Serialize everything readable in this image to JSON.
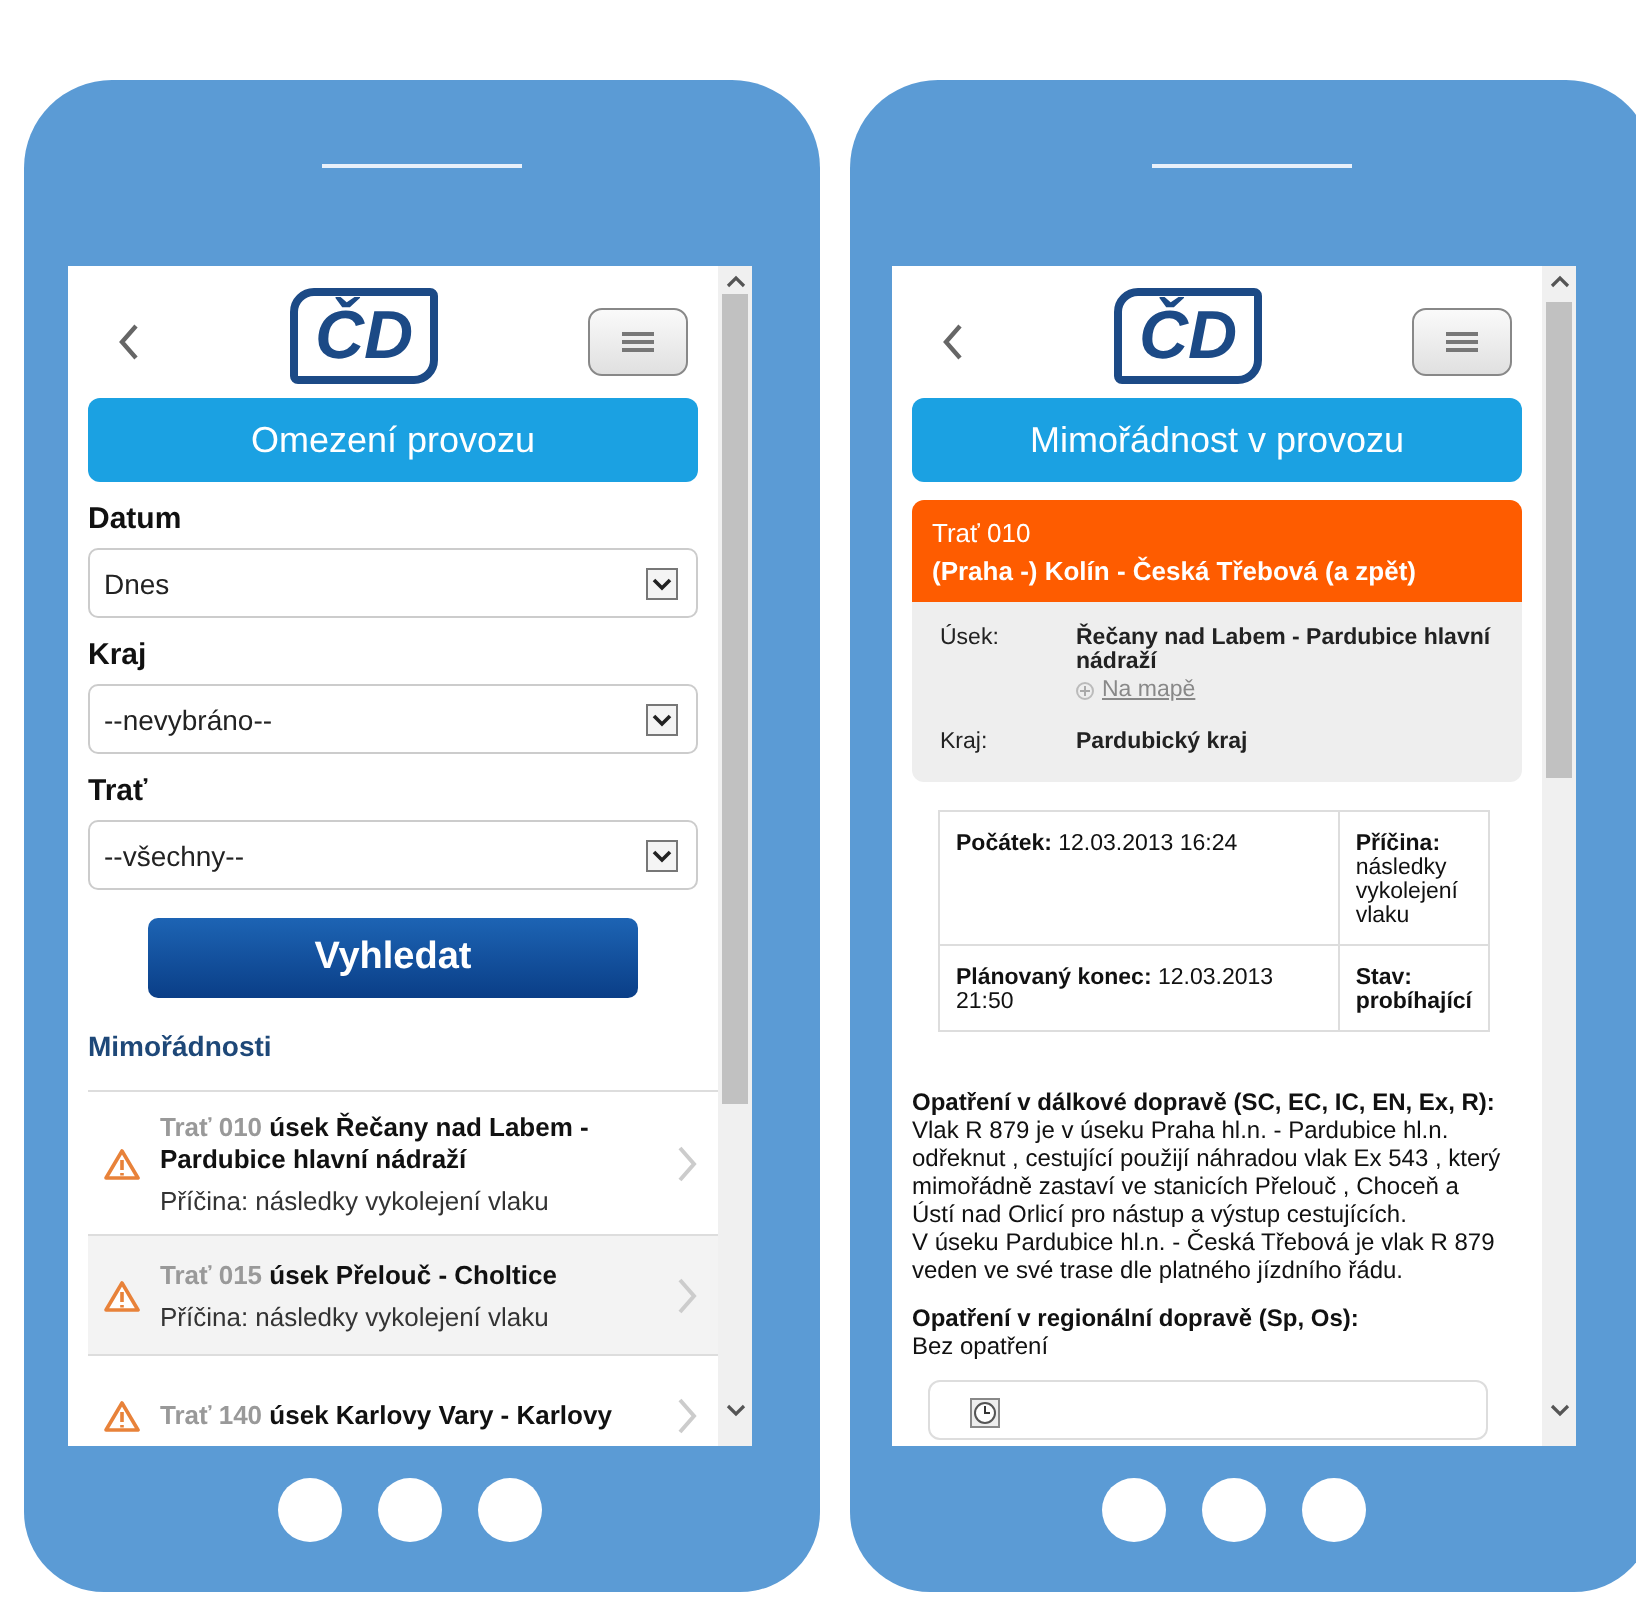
{
  "left_screen": {
    "logo": "ČD",
    "title": "Omezení provozu",
    "fields": [
      {
        "label": "Datum",
        "value": "Dnes"
      },
      {
        "label": "Kraj",
        "value": "--nevybráno--"
      },
      {
        "label": "Trať",
        "value": "--všechny--"
      }
    ],
    "search_button": "Vyhledat",
    "section_title": "Mimořádnosti",
    "incidents": [
      {
        "route": "Trať 010",
        "section": "úsek Řečany nad Labem - Pardubice hlavní nádraží",
        "cause": "Příčina: následky vykolejení vlaku"
      },
      {
        "route": "Trať 015",
        "section": "úsek Přelouč - Choltice",
        "cause": "Příčina: následky vykolejení vlaku"
      },
      {
        "route": "Trať 140",
        "section": "úsek Karlovy Vary - Karlovy"
      }
    ]
  },
  "right_screen": {
    "logo": "ČD",
    "title": "Mimořádnost v provozu",
    "line": {
      "number": "Trať 010",
      "name": "(Praha -) Kolín - Česká Třebová (a zpět)"
    },
    "details": [
      {
        "label": "Úsek:",
        "value": "Řečany nad Labem - Pardubice hlavní nádraží",
        "link": "Na mapě"
      },
      {
        "label": "Kraj:",
        "value": "Pardubický kraj"
      }
    ],
    "table": [
      [
        {
          "label": "Počátek:",
          "value": "12.03.2013 16:24",
          "value_bold": false
        },
        {
          "label": "Příčina:",
          "value": "následky vykolejení vlaku",
          "value_bold": false
        }
      ],
      [
        {
          "label": "Plánovaný konec:",
          "value": "12.03.2013 21:50",
          "value_bold": false
        },
        {
          "label": "Stav:",
          "value": "probíhající",
          "value_bold": true
        }
      ]
    ],
    "measures": [
      {
        "heading": "Opatření v dálkové dopravě (SC, EC, IC, EN, Ex, R):",
        "paragraphs": [
          "Vlak R 879 je v úseku Praha hl.n. - Pardubice hl.n. odřeknut , cestující použijí náhradou vlak Ex 543 , který mimořádně zastaví ve stanicích Přelouč , Choceň a Ústí nad Orlicí pro nástup a výstup cestujících.",
          "V úseku Pardubice hl.n. - Česká Třebová je vlak R 879 veden ve své trase dle platného jízdního řádu."
        ]
      },
      {
        "heading": "Opatření v regionální dopravě (Sp, Os):",
        "paragraphs": [
          "Bez opatření"
        ]
      }
    ]
  }
}
